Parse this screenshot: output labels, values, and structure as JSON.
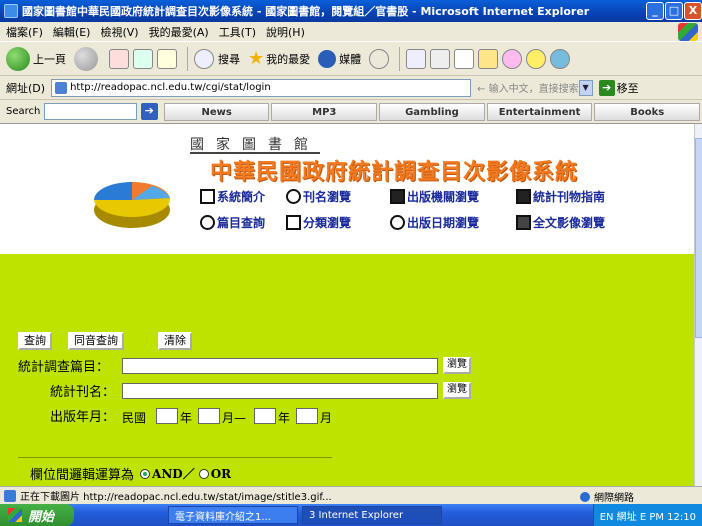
{
  "window": {
    "title": "國家圖書館中華民國政府統計調查目次影像系統 - 國家圖書館，閱覽組／官書股 - Microsoft Internet Explorer",
    "minimize": "_",
    "maximize": "□",
    "close": "X"
  },
  "menu": [
    "檔案(F)",
    "編輯(E)",
    "檢視(V)",
    "我的最愛(A)",
    "工具(T)",
    "說明(H)"
  ],
  "toolbar": {
    "back": "上一頁",
    "search": "搜尋",
    "favorites": "我的最愛",
    "media": "媒體"
  },
  "address": {
    "label": "網址(D)",
    "url": "http://readopac.ncl.edu.tw/cgi/stat/login",
    "hint": "← 输入中文，直接搜索",
    "go": "移至"
  },
  "linksbar": {
    "search_label": "Search",
    "tabs": [
      "News",
      "MP3",
      "Gambling",
      "Entertainment",
      "Books"
    ]
  },
  "header": {
    "library": "國家圖書館",
    "system_title": "中華民國政府統計調查目次影像系統",
    "nav": [
      "系統簡介",
      "刊名瀏覽",
      "出版機關瀏覽",
      "統計刊物指南",
      "篇目查詢",
      "分類瀏覽",
      "出版日期瀏覽",
      "全文影像瀏覽"
    ]
  },
  "form": {
    "buttons": [
      "查詢",
      "同音查詢",
      "清除"
    ],
    "article_label": "統計調查篇目：",
    "journal_label": "統計刊名：",
    "date_label": "出版年月：",
    "roc": "民國",
    "year": "年",
    "month_to": "月—",
    "year2": "年",
    "month": "月",
    "browse": "瀏覽",
    "logic_label": "欄位間邏輯運算為",
    "and": "AND／",
    "or": "OR"
  },
  "status": {
    "text": "正在下載圖片 http://readopac.ncl.edu.tw/stat/image/stitle3.gif...",
    "zone": "網際網路"
  },
  "taskbar": {
    "start": "開始",
    "items": [
      "電子資料庫介紹之1...",
      "3 Internet Explorer"
    ],
    "tray": "EN   網址 E   PM 12:10"
  },
  "colors": {
    "title_orange": "#f37a20",
    "form_bg": "#bfe301",
    "nav_blue": "#1a2a9a"
  }
}
